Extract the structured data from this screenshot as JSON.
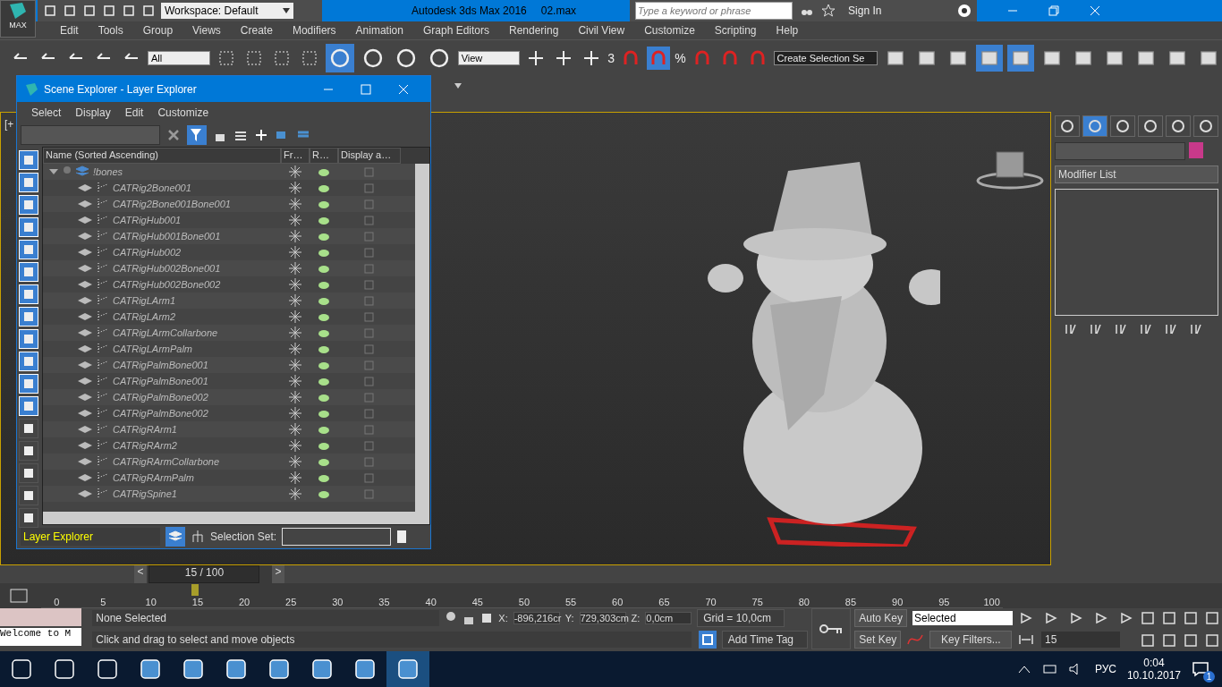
{
  "title_bar": {
    "logo_label": "MAX",
    "workspace": "Workspace: Default",
    "title": "Autodesk 3ds Max 2016",
    "file": "02.max",
    "search": {
      "placeholder": "Type a keyword or phrase"
    },
    "sign_in": "Sign In"
  },
  "menu": [
    "Edit",
    "Tools",
    "Group",
    "Views",
    "Create",
    "Modifiers",
    "Animation",
    "Graph Editors",
    "Rendering",
    "Civil View",
    "Customize",
    "Scripting",
    "Help"
  ],
  "toolbar": {
    "selection_filter": "All",
    "reference_coord": "View",
    "snap_label": "3",
    "percent_snap_label": "%",
    "selection_set": "Create Selection Se"
  },
  "viewport": {
    "label": "[+"
  },
  "scene_explorer": {
    "title": "Scene Explorer - Layer Explorer",
    "menu": [
      "Select",
      "Display",
      "Edit",
      "Customize"
    ],
    "columns": [
      "Name (Sorted Ascending)",
      "Fr…",
      "R…",
      "Display a…"
    ],
    "layers": [
      {
        "name": "!bones",
        "expanded": true,
        "children": [
          {
            "name": "CATRig2Bone001"
          },
          {
            "name": "CATRig2Bone001Bone001"
          },
          {
            "name": "CATRigHub001"
          },
          {
            "name": "CATRigHub001Bone001"
          },
          {
            "name": "CATRigHub002"
          },
          {
            "name": "CATRigHub002Bone001"
          },
          {
            "name": "CATRigHub002Bone002"
          },
          {
            "name": "CATRigLArm1"
          },
          {
            "name": "CATRigLArm2"
          },
          {
            "name": "CATRigLArmCollarbone"
          },
          {
            "name": "CATRigLArmPalm"
          },
          {
            "name": "CATRigPalmBone001"
          },
          {
            "name": "CATRigPalmBone001"
          },
          {
            "name": "CATRigPalmBone002"
          },
          {
            "name": "CATRigPalmBone002"
          },
          {
            "name": "CATRigRArm1"
          },
          {
            "name": "CATRigRArm2"
          },
          {
            "name": "CATRigRArmCollarbone"
          },
          {
            "name": "CATRigRArmPalm"
          },
          {
            "name": "CATRigSpine1"
          }
        ]
      }
    ],
    "explorer_mode": "Layer Explorer",
    "selection_set_label": "Selection Set:"
  },
  "command_panel": {
    "modifier_list": "Modifier List"
  },
  "time_slider": {
    "prev": "<",
    "position": "15 / 100",
    "next": ">",
    "level": 0.15
  },
  "timeline_ticks": [
    "0",
    "5",
    "10",
    "15",
    "20",
    "25",
    "30",
    "35",
    "40",
    "45",
    "50",
    "55",
    "60",
    "65",
    "70",
    "75",
    "80",
    "85",
    "90",
    "95",
    "100"
  ],
  "status": {
    "listener_text": "Welcome to M",
    "selection": "None Selected",
    "x_label": "X:",
    "x": "-896,216cr",
    "y_label": "Y:",
    "y": "729,303cm",
    "z_label": "Z:",
    "z": "0,0cm",
    "grid": "Grid = 10,0cm",
    "prompt": "Click and drag to select and move objects",
    "add_time_tag": "Add Time Tag",
    "auto_key": "Auto Key",
    "key_mode": "Selected",
    "set_key": "Set Key",
    "key_filters": "Key Filters...",
    "frame": "15"
  },
  "taskbar": {
    "language": "РУС",
    "time": "0:04",
    "date": "10.10.2017",
    "notifications": "1"
  }
}
